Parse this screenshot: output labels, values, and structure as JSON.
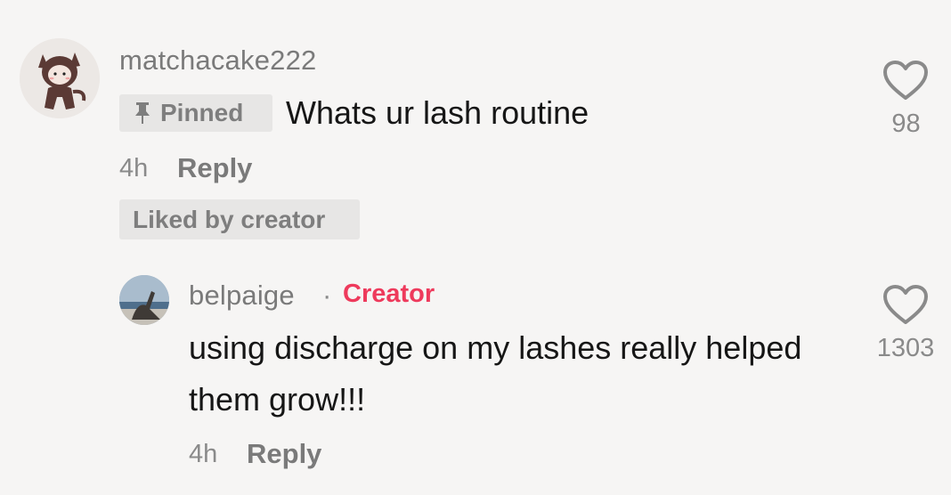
{
  "comments": [
    {
      "username": "matchacake222",
      "pinned_label": "Pinned",
      "text": "Whats ur lash routine",
      "time": "4h",
      "reply_label": "Reply",
      "liked_label": "Liked by creator",
      "like_count": "98",
      "avatar_icon": "cat-costume-avatar",
      "pin_icon": "pushpin-icon"
    },
    {
      "username": "belpaige",
      "separator": "·",
      "badge": "Creator",
      "text": "using discharge on my lashes really helped them grow!!!",
      "time": "4h",
      "reply_label": "Reply",
      "like_count": "1303",
      "avatar_icon": "beach-photo-avatar"
    }
  ],
  "colors": {
    "background": "#f6f5f4",
    "creator_badge": "#ee3a5c",
    "text_primary": "#161616",
    "text_secondary": "#7a7a7a",
    "tag_background": "#e7e6e5"
  }
}
